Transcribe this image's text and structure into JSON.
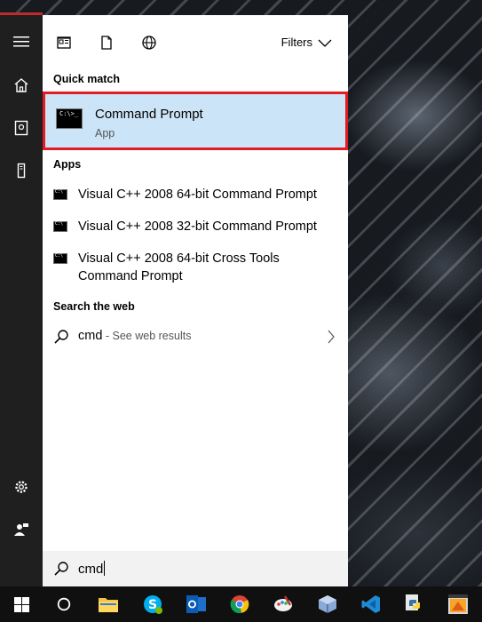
{
  "toolbar": {
    "filters_label": "Filters"
  },
  "sections": {
    "quick_match": "Quick match",
    "apps": "Apps",
    "search_web": "Search the web"
  },
  "quick_match": {
    "title": "Command Prompt",
    "subtitle": "App",
    "icon_text": "C:\\>_"
  },
  "apps": [
    {
      "label": "Visual C++ 2008 64-bit Command Prompt"
    },
    {
      "label": "Visual C++ 2008 32-bit Command Prompt"
    },
    {
      "label": "Visual C++ 2008 64-bit Cross Tools Command Prompt"
    }
  ],
  "web": {
    "query": "cmd",
    "suffix": " - See web results"
  },
  "search": {
    "value": "cmd"
  },
  "colors": {
    "highlight": "#cce4f7",
    "outline": "#e31b23",
    "accent": "#c1292e"
  },
  "taskbar_icons": [
    "windows-start-icon",
    "cortana-icon",
    "file-explorer-icon",
    "skype-icon",
    "outlook-icon",
    "chrome-icon",
    "paint-icon",
    "virtualbox-icon",
    "vscode-icon",
    "python-icon",
    "app-icon"
  ]
}
